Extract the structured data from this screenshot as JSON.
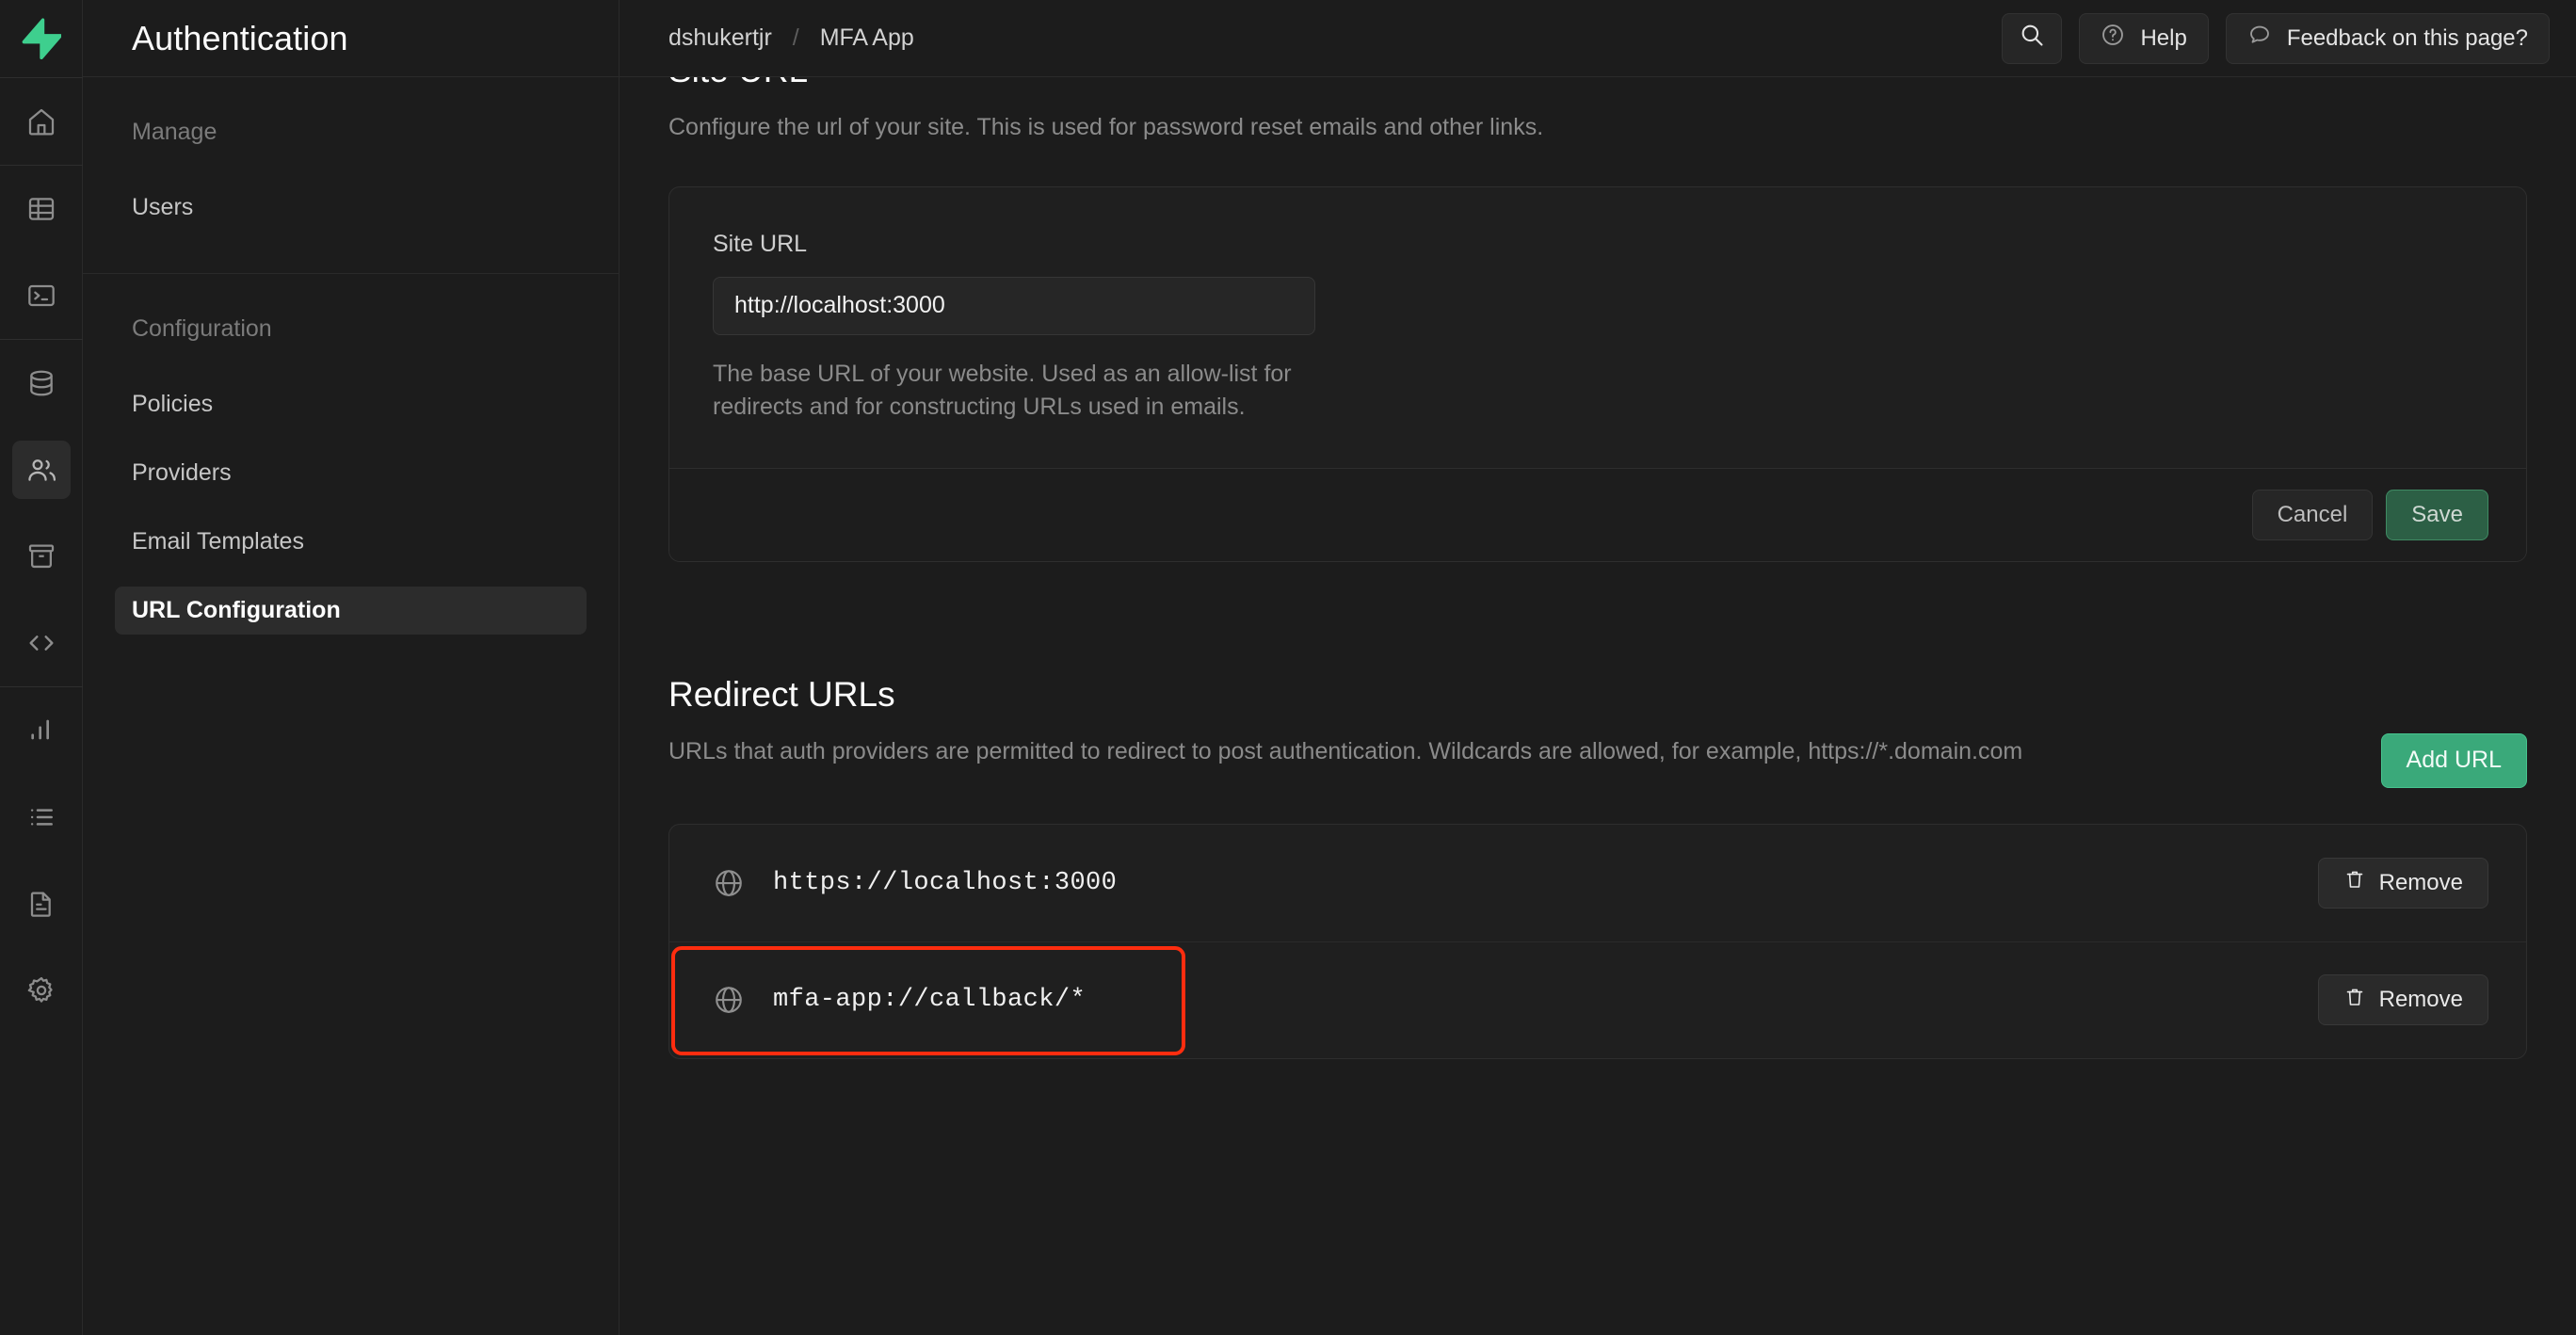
{
  "rail": {
    "logo_icon": "supabase-logo-icon",
    "items": [
      {
        "icon": "home-icon",
        "name": "home"
      },
      {
        "icon": "table-editor-icon",
        "name": "table-editor"
      },
      {
        "icon": "sql-editor-icon",
        "name": "sql-editor"
      },
      {
        "icon": "database-icon",
        "name": "database"
      },
      {
        "icon": "authentication-users-icon",
        "name": "authentication",
        "active": true
      },
      {
        "icon": "storage-box-icon",
        "name": "storage"
      },
      {
        "icon": "code-brackets-icon",
        "name": "edge-functions"
      },
      {
        "icon": "bar-chart-icon",
        "name": "reports"
      },
      {
        "icon": "list-icon",
        "name": "logs"
      },
      {
        "icon": "document-icon",
        "name": "api-docs"
      },
      {
        "icon": "gear-icon",
        "name": "settings"
      }
    ]
  },
  "sidebar": {
    "title": "Authentication",
    "groups": [
      {
        "label": "Manage",
        "items": [
          {
            "label": "Users",
            "selected": false
          }
        ]
      },
      {
        "label": "Configuration",
        "items": [
          {
            "label": "Policies",
            "selected": false
          },
          {
            "label": "Providers",
            "selected": false
          },
          {
            "label": "Email Templates",
            "selected": false
          },
          {
            "label": "URL Configuration",
            "selected": true
          }
        ]
      }
    ]
  },
  "topbar": {
    "breadcrumb": {
      "org": "dshukertjr",
      "separator": "/",
      "project": "MFA App"
    },
    "search_icon": "search-icon",
    "help_icon": "question-circle-icon",
    "help_label": "Help",
    "feedback_icon": "chat-bubble-icon",
    "feedback_label": "Feedback on this page?"
  },
  "site_url": {
    "title": "Site URL",
    "description": "Configure the url of your site. This is used for password reset emails and other links.",
    "field_label": "Site URL",
    "field_value": "http://localhost:3000",
    "field_help": "The base URL of your website. Used as an allow-list for redirects and for constructing URLs used in emails.",
    "cancel_label": "Cancel",
    "save_label": "Save"
  },
  "redirect_urls": {
    "title": "Redirect URLs",
    "description": "URLs that auth providers are permitted to redirect to post authentication. Wildcards are allowed, for example, https://*.domain.com",
    "add_label": "Add URL",
    "remove_label": "Remove",
    "rows": [
      {
        "url": "https://localhost:3000",
        "icon": "globe-icon",
        "highlighted": false
      },
      {
        "url": "mfa-app://callback/*",
        "icon": "globe-icon",
        "highlighted": true
      }
    ]
  },
  "colors": {
    "brand_green": "#3aa97a",
    "save_green": "#2c5f45",
    "highlight_red": "#ff2d0f",
    "page_bg": "#1c1c1c",
    "card_bg": "#1f1f1f"
  }
}
